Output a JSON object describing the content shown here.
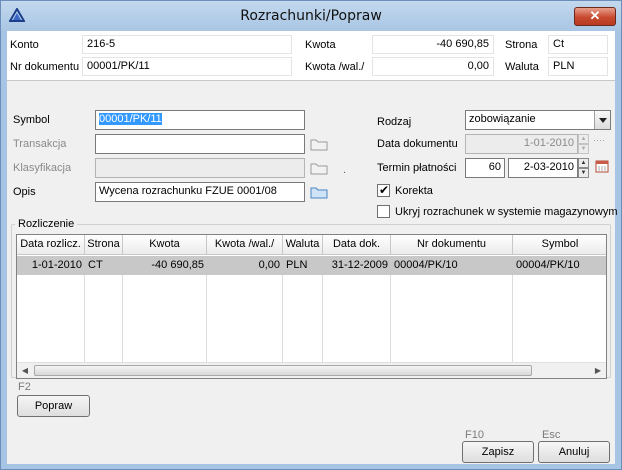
{
  "window": {
    "title": "Rozrachunki/Popraw",
    "close_label": "✕"
  },
  "info": {
    "konto_label": "Konto",
    "konto_value": "216-5",
    "nr_dokumentu_label": "Nr dokumentu",
    "nr_dokumentu_value": "00001/PK/11",
    "kwota_label": "Kwota",
    "kwota_value": "-40 690,85",
    "kwota_wal_label": "Kwota /wal./",
    "kwota_wal_value": "0,00",
    "strona_label": "Strona",
    "strona_value": "Ct",
    "waluta_label": "Waluta",
    "waluta_value": "PLN"
  },
  "form": {
    "symbol_label": "Symbol",
    "symbol_value": "00001/PK/11",
    "transakcja_label": "Transakcja",
    "transakcja_value": "",
    "klasyfikacja_label": "Klasyfikacja",
    "klasyfikacja_value": "",
    "opis_label": "Opis",
    "opis_value": "Wycena rozrachunku FZUE 0001/08",
    "rodzaj_label": "Rodzaj",
    "rodzaj_value": "zobowiązanie",
    "data_dokumentu_label": "Data dokumentu",
    "data_dokumentu_value": "1-01-2010",
    "termin_label": "Termin płatności",
    "termin_days": "60",
    "termin_date": "2-03-2010",
    "korekta_label": "Korekta",
    "korekta_checked": "✔",
    "ukryj_label": "Ukryj rozrachunek w systemie magazynowym",
    "separator_dot": "."
  },
  "rozliczenie": {
    "title": "Rozliczenie",
    "columns": [
      "Data rozlicz.",
      "Strona",
      "Kwota",
      "Kwota /wal./",
      "Waluta",
      "Data dok.",
      "Nr dokumentu",
      "Symbol"
    ],
    "rows": [
      [
        "1-01-2010",
        "CT",
        "-40 690,85",
        "0,00",
        "PLN",
        "31-12-2009",
        "00004/PK/10",
        "00004/PK/10"
      ]
    ]
  },
  "buttons": {
    "popraw_key": "F2",
    "popraw_label": "Popraw",
    "zapisz_key": "F10",
    "zapisz_label": "Zapisz",
    "anuluj_key": "Esc",
    "anuluj_label": "Anuluj"
  },
  "colors": {
    "selection": "#3399ff",
    "close": "#c84a2e",
    "title_bar": "#a9c6e4",
    "row_highlight": "#c8c8c8"
  }
}
